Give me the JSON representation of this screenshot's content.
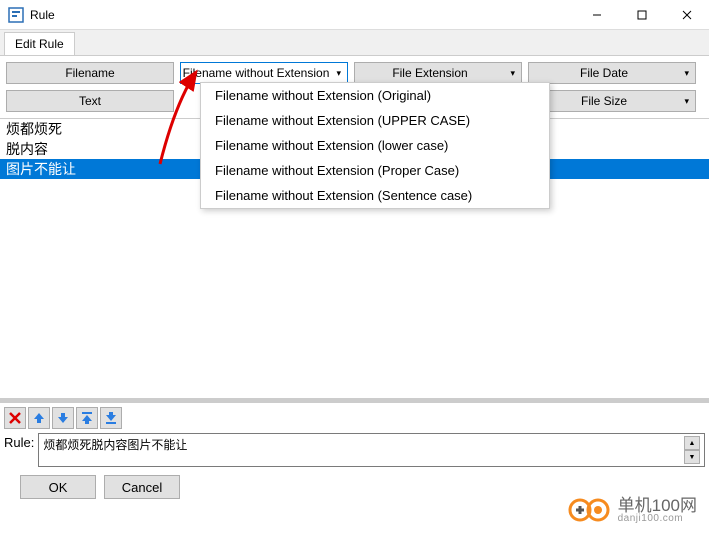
{
  "window": {
    "title": "Rule"
  },
  "tabs": {
    "edit": "Edit Rule"
  },
  "toolbar": {
    "filename": "Filename",
    "fn_no_ext": "Filename without Extension",
    "file_ext": "File Extension",
    "file_date": "File Date",
    "text": "Text",
    "file_size": "File Size"
  },
  "list": {
    "items": [
      "烦都烦死",
      "脱内容",
      "图片不能让"
    ],
    "selected_index": 2
  },
  "dropdown": {
    "items": [
      "Filename without Extension (Original)",
      "Filename without Extension (UPPER CASE)",
      "Filename without Extension (lower case)",
      "Filename without Extension (Proper Case)",
      "Filename without Extension (Sentence case)"
    ]
  },
  "bottom": {
    "rule_label": "Rule:",
    "rule_value": "烦都烦死脱内容图片不能让",
    "ok": "OK",
    "cancel": "Cancel"
  },
  "watermark": {
    "line1": "单机100网",
    "line2": "danji100.com"
  },
  "colors": {
    "accent": "#0078d7",
    "brand_orange": "#f68b1f"
  }
}
